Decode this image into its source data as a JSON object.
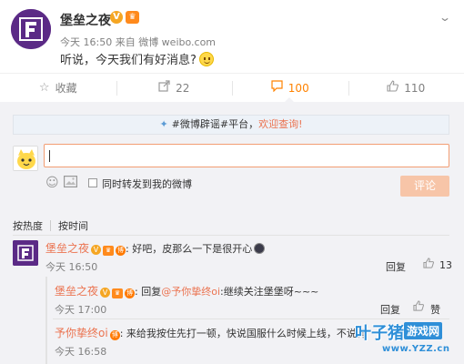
{
  "post": {
    "author": "堡垒之夜",
    "verified_icon": "V",
    "level_icon": "crown-icon",
    "meta": "今天 16:50 来自 微博 weibo.com",
    "text": "听说，今天我们有好消息?",
    "emoji": "smile-emoji"
  },
  "actions": [
    {
      "icon": "star-icon",
      "label": "收藏"
    },
    {
      "icon": "share-icon",
      "label": "22"
    },
    {
      "icon": "comment-icon",
      "label": "100"
    },
    {
      "icon": "thumb-icon",
      "label": "110"
    }
  ],
  "notice": {
    "prefix": "#微博辟谣#平台，",
    "link": "欢迎查询!"
  },
  "composer": {
    "input_value": "",
    "checkbox_label": "同时转发到我的微博",
    "submit_label": "评论"
  },
  "sort": {
    "tabs": [
      "按热度",
      "按时间"
    ]
  },
  "comments": [
    {
      "author": "堡垒之夜",
      "text": ": 好吧，皮那么一下是很开心",
      "time": "今天 16:50",
      "reply_label": "回复",
      "likes": "13"
    }
  ],
  "replies": [
    {
      "author": "堡垒之夜",
      "reply_prefix": ": 回复",
      "mention": "@予你挚终oi",
      "text": ":继续关注堡堡呀~~~",
      "time": "今天 17:00",
      "reply_label": "回复",
      "like_label": "赞"
    },
    {
      "author": "予你挚终oi",
      "text": ": 来给我按住先打一顿，快说国服什么时候上线，不说再",
      "time": "今天 16:58"
    }
  ],
  "watermark": {
    "main": "叶子猪",
    "box": "游戏网",
    "url": "www.YZZ.cn"
  }
}
